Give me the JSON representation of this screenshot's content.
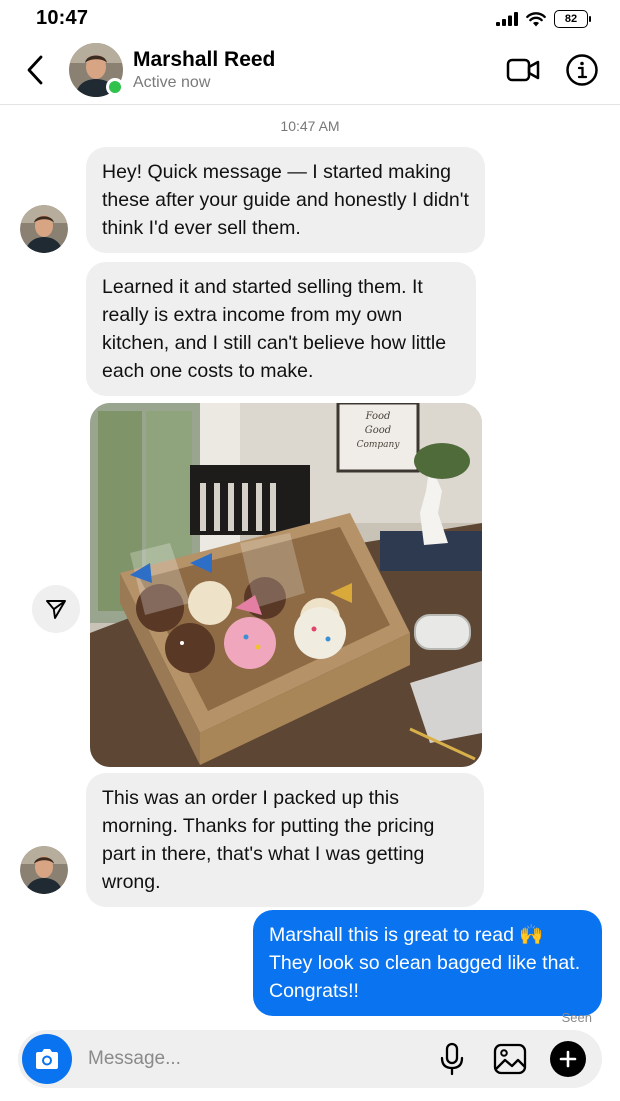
{
  "status_bar": {
    "time": "10:47",
    "battery": "82"
  },
  "header": {
    "back_icon": "chevron-left-icon",
    "name": "Marshall Reed",
    "status": "Active now",
    "video_icon": "video-camera-icon",
    "info_icon": "info-icon"
  },
  "conversation": {
    "timestamp": "10:47 AM",
    "messages": [
      {
        "from": "Marshall Reed",
        "text": "Hey! Quick message — I started making these after your guide and honestly I didn't think I'd ever sell them."
      },
      {
        "from": "Marshall Reed",
        "text": "Learned it and started selling them. It really is extra income from my own kitchen, and I still can't believe how little each one costs to make."
      },
      {
        "from": "Marshall Reed",
        "type": "photo",
        "photo_text": [
          "Food",
          "Good",
          "Company"
        ]
      },
      {
        "from": "Marshall Reed",
        "text": "This was an order I packed up this morning. Thanks for putting the pricing part in there, that's what I was getting wrong."
      },
      {
        "from": "me",
        "text": "Marshall this is great to read 🙌 They look so clean bagged like that. Congrats!!"
      }
    ],
    "seen": "Seen"
  },
  "composer": {
    "placeholder": "Message...",
    "camera_icon": "camera-icon",
    "mic_icon": "microphone-icon",
    "gallery_icon": "gallery-icon",
    "plus_icon": "plus-icon"
  },
  "colors": {
    "accent": "#0a74f0",
    "incoming_bubble": "#efefef",
    "online": "#31c24d"
  }
}
